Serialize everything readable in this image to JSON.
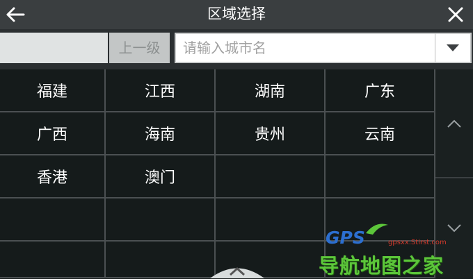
{
  "header": {
    "title": "区域选择",
    "back_icon": "arrow-left-icon",
    "close_icon": "close-icon"
  },
  "search": {
    "region_value": "",
    "up_level_label": "上一级",
    "city_placeholder": "请输入城市名",
    "city_value": "",
    "dropdown_icon": "triangle-down-icon"
  },
  "regions": [
    [
      "福建",
      "江西",
      "湖南",
      "广东"
    ],
    [
      "广西",
      "海南",
      "贵州",
      "云南"
    ],
    [
      "香港",
      "澳门",
      "",
      ""
    ],
    [
      "",
      "",
      "",
      ""
    ],
    [
      "",
      "",
      "",
      ""
    ]
  ],
  "scroll": {
    "up_icon": "chevron-up-icon",
    "down_icon": "chevron-down-icon"
  },
  "watermark": {
    "logo_text": "GPS",
    "url": "gpsxx.Stirst.com",
    "site_name": "导航地图之家"
  },
  "colors": {
    "titlebar_bg": "#3a3e40",
    "grid_bg": "#151b1b",
    "grid_line": "#4b5052",
    "text": "#ffffff",
    "watermark_blue": "#2c6fd0",
    "watermark_green": "#5cc63a"
  }
}
